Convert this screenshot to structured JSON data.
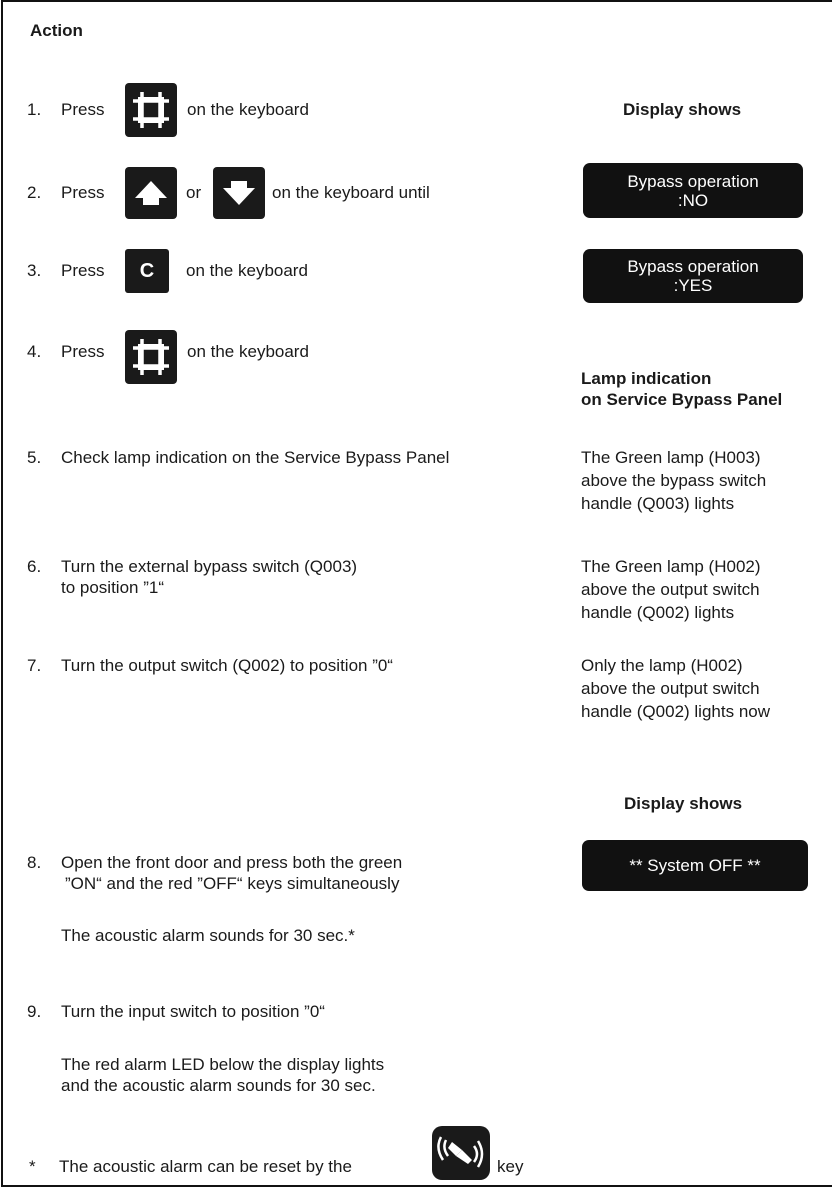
{
  "header": {
    "action": "Action"
  },
  "right_headings": {
    "display_shows_1": "Display shows",
    "lamp_indication_line1": "Lamp indication",
    "lamp_indication_line2": "on Service Bypass Panel",
    "display_shows_2": "Display shows"
  },
  "steps": {
    "s1": {
      "num": "1.",
      "press": "Press",
      "tail": "on the keyboard"
    },
    "s2": {
      "num": "2.",
      "press": "Press",
      "or": "or",
      "tail": "on the keyboard until"
    },
    "s3": {
      "num": "3.",
      "press": "Press",
      "tail": "on the keyboard"
    },
    "s4": {
      "num": "4.",
      "press": "Press",
      "tail": "on the keyboard"
    },
    "s5": {
      "num": "5.",
      "text": "Check lamp indication on the Service Bypass Panel"
    },
    "s6": {
      "num": "6.",
      "line1": "Turn the external bypass switch (Q003)",
      "line2": "to position ”1“"
    },
    "s7": {
      "num": "7.",
      "text": "Turn the output switch (Q002) to position ”0“"
    },
    "s8": {
      "num": "8.",
      "line1": "Open the front door and press both the green",
      "line2": "”ON“ and the red ”OFF“ keys simultaneously",
      "note": "The acoustic alarm sounds for 30 sec.*"
    },
    "s9": {
      "num": "9.",
      "line1": "Turn the input switch to position ”0“",
      "note1": "The red alarm LED below the display lights",
      "note2": "and the acoustic alarm sounds for 30 sec."
    }
  },
  "displays": {
    "bypass_no": {
      "line1": "Bypass operation",
      "line2": ":NO"
    },
    "bypass_yes": {
      "line1": "Bypass operation",
      "line2": ":YES"
    },
    "system_off": {
      "line1": "** System OFF **"
    }
  },
  "lamps": {
    "l5": {
      "line1": "The Green lamp (H003)",
      "line2": "above the bypass switch",
      "line3": "handle (Q003) lights"
    },
    "l6": {
      "line1": "The Green lamp (H002)",
      "line2": "above the output switch",
      "line3": "handle (Q002) lights"
    },
    "l7": {
      "line1": "Only the lamp (H002)",
      "line2": "above the output switch",
      "line3": "handle (Q002) lights now"
    }
  },
  "footnote": {
    "star": "*",
    "text": "The acoustic alarm can be reset by the",
    "key_word": "key"
  },
  "icons": {
    "menu_key": "frame-icon",
    "up_key": "arrow-up-icon",
    "down_key": "arrow-down-icon",
    "c_key": "c-key-icon",
    "c_key_label": "C",
    "alarm_reset_key": "alarm-reset-icon"
  }
}
